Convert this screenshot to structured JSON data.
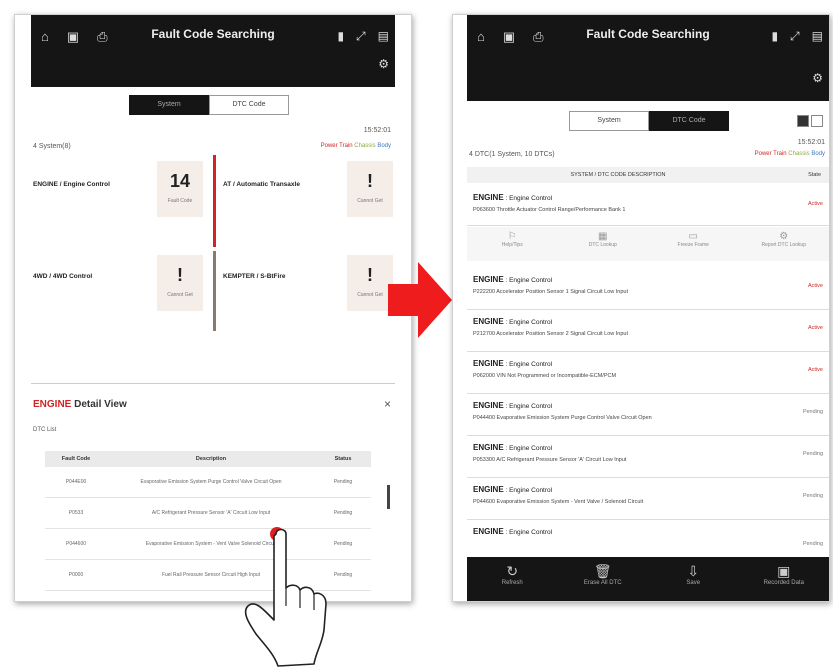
{
  "left": {
    "title": "Fault Code Searching",
    "tabs": [
      "System",
      "DTC Code"
    ],
    "time": "15:52:01",
    "system_count": "4 System(8)",
    "legend": {
      "power_train": "Power Train",
      "chassis": "Chassis",
      "body": "Body"
    },
    "systems": [
      {
        "name": "ENGINE / Engine Control",
        "value": "14",
        "label": "Fault Code",
        "bar": "#d12525"
      },
      {
        "name": "AT / Automatic Transaxle",
        "value": "!",
        "label": "Cannot Get",
        "bar": "#d12525"
      },
      {
        "name": "4WD / 4WD Control",
        "value": "!",
        "label": "Cannot Get",
        "bar": "#8b7a6b"
      },
      {
        "name": "KEMPTER / S-BtFire",
        "value": "!",
        "label": "Cannot Get",
        "bar": "#8b7a6b"
      }
    ],
    "panel": {
      "brand": "ENGINE",
      "title": " Detail View",
      "close": "×",
      "subtitle": "DTC List",
      "headers": [
        "Fault Code",
        "Description",
        "Status"
      ],
      "rows": [
        {
          "code": "P044E00",
          "desc": "Evaporative Emission System Purge Control Valve Circuit Open",
          "status": "Pending"
        },
        {
          "code": "P0533",
          "desc": "A/C Refrigerant Pressure Sensor 'A' Circuit Low Input",
          "status": "Pending"
        },
        {
          "code": "P044600",
          "desc": "Evaporative Emission System - Vent Valve Solenoid Circuit",
          "status": "Pending"
        },
        {
          "code": "P0000",
          "desc": "Fuel Rail Pressure Sensor Circuit High Input",
          "status": "Pending"
        }
      ]
    }
  },
  "right": {
    "title": "Fault Code Searching",
    "tabs": [
      "System",
      "DTC Code"
    ],
    "time": "15:52:01",
    "count": "4 DTC(1 System, 10 DTCs)",
    "legend": {
      "power_train": "Power Train",
      "chassis": "Chassis",
      "body": "Body"
    },
    "table_header": {
      "desc": "SYSTEM / DTC CODE DESCRIPTION",
      "status": "State"
    },
    "rows": [
      {
        "brand": "ENGINE",
        "sys": " : Engine Control",
        "desc": "P063600 Throttle Actuator Control Range/Performance Bank 1",
        "status": "Active"
      },
      {
        "brand": "ENGINE",
        "sys": " : Engine Control",
        "desc": "P222200 Accelerator Position Sensor 1 Signal Circuit Low Input",
        "status": "Active"
      },
      {
        "brand": "ENGINE",
        "sys": " : Engine Control",
        "desc": "P212700 Accelerator Position Sensor 2 Signal Circuit Low Input",
        "status": "Active"
      },
      {
        "brand": "ENGINE",
        "sys": " : Engine Control",
        "desc": "P062000 VIN Not Programmed or Incompatible-ECM/PCM",
        "status": "Active"
      },
      {
        "brand": "ENGINE",
        "sys": " : Engine Control",
        "desc": "P044400 Evaporative Emission System Purge Control Valve Circuit Open",
        "status": "Pending"
      },
      {
        "brand": "ENGINE",
        "sys": " : Engine Control",
        "desc": "P053300 A/C Refrigerant Pressure Sensor 'A' Circuit Low Input",
        "status": "Pending"
      },
      {
        "brand": "ENGINE",
        "sys": " : Engine Control",
        "desc": "P044600 Evaporative Emission System - Vent Valve / Solenoid Circuit",
        "status": "Pending"
      },
      {
        "brand": "ENGINE",
        "sys": " : Engine Control",
        "desc": "",
        "status": "Pending"
      }
    ],
    "actions": [
      "Help/Tips",
      "DTC Lookup",
      "Freeze Frame",
      "Report DTC Lookup"
    ],
    "bottom": [
      "Refresh",
      "Erase All DTC",
      "Save",
      "Recorded Data"
    ]
  }
}
